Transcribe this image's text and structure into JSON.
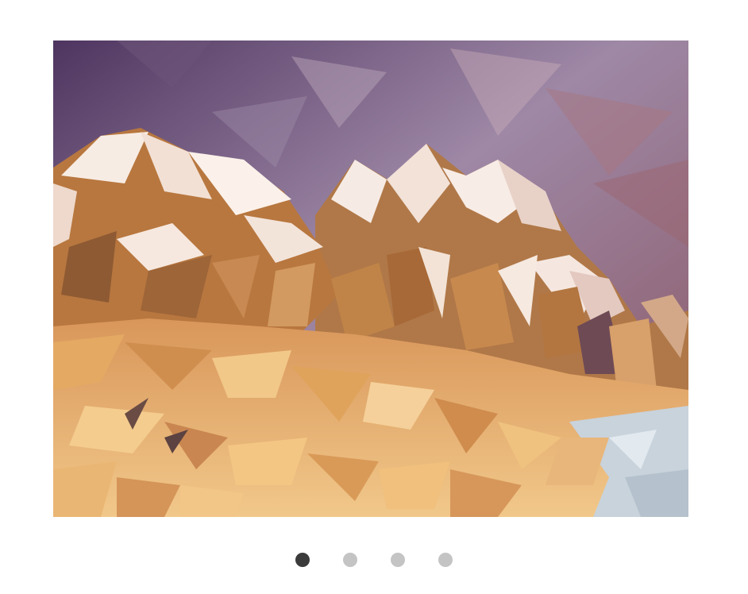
{
  "carousel": {
    "slide": {
      "image_subject": "low-poly-mountain-landscape",
      "colors": {
        "sky_top": "#5b3e6b",
        "sky_mid": "#9a7f9f",
        "sky_right": "#8a5a64",
        "peak_snow": "#f4e6dc",
        "rock_dark": "#a86a3e",
        "rock_mid": "#c98d52",
        "ground_light": "#f0c27a",
        "ground_mid": "#e3a85a",
        "water": "#c9d4de"
      }
    },
    "pagination": {
      "count": 4,
      "active_index": 0,
      "active_color": "#3b3b3b",
      "inactive_color": "#c4c4c4"
    }
  }
}
